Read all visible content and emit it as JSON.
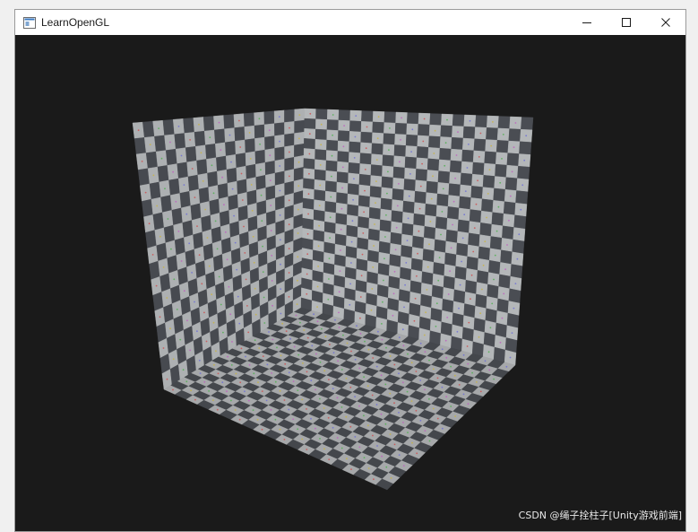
{
  "window": {
    "title": "LearnOpenGL",
    "app_icon": "window-app-icon",
    "controls": [
      {
        "name": "minimize-icon",
        "label": "Minimize"
      },
      {
        "name": "maximize-icon",
        "label": "Maximize"
      },
      {
        "name": "close-icon",
        "label": "Close"
      }
    ]
  },
  "scene": {
    "background_color": "#1a1a1a",
    "texture": "checkerboard",
    "light_square_color": "#b4b7b9",
    "dark_square_color": "#4a4d53",
    "faces": [
      "left-wall",
      "back-wall",
      "floor"
    ]
  },
  "watermark": {
    "text": "CSDN @绳子拴柱子[Unity游戏前端]"
  }
}
